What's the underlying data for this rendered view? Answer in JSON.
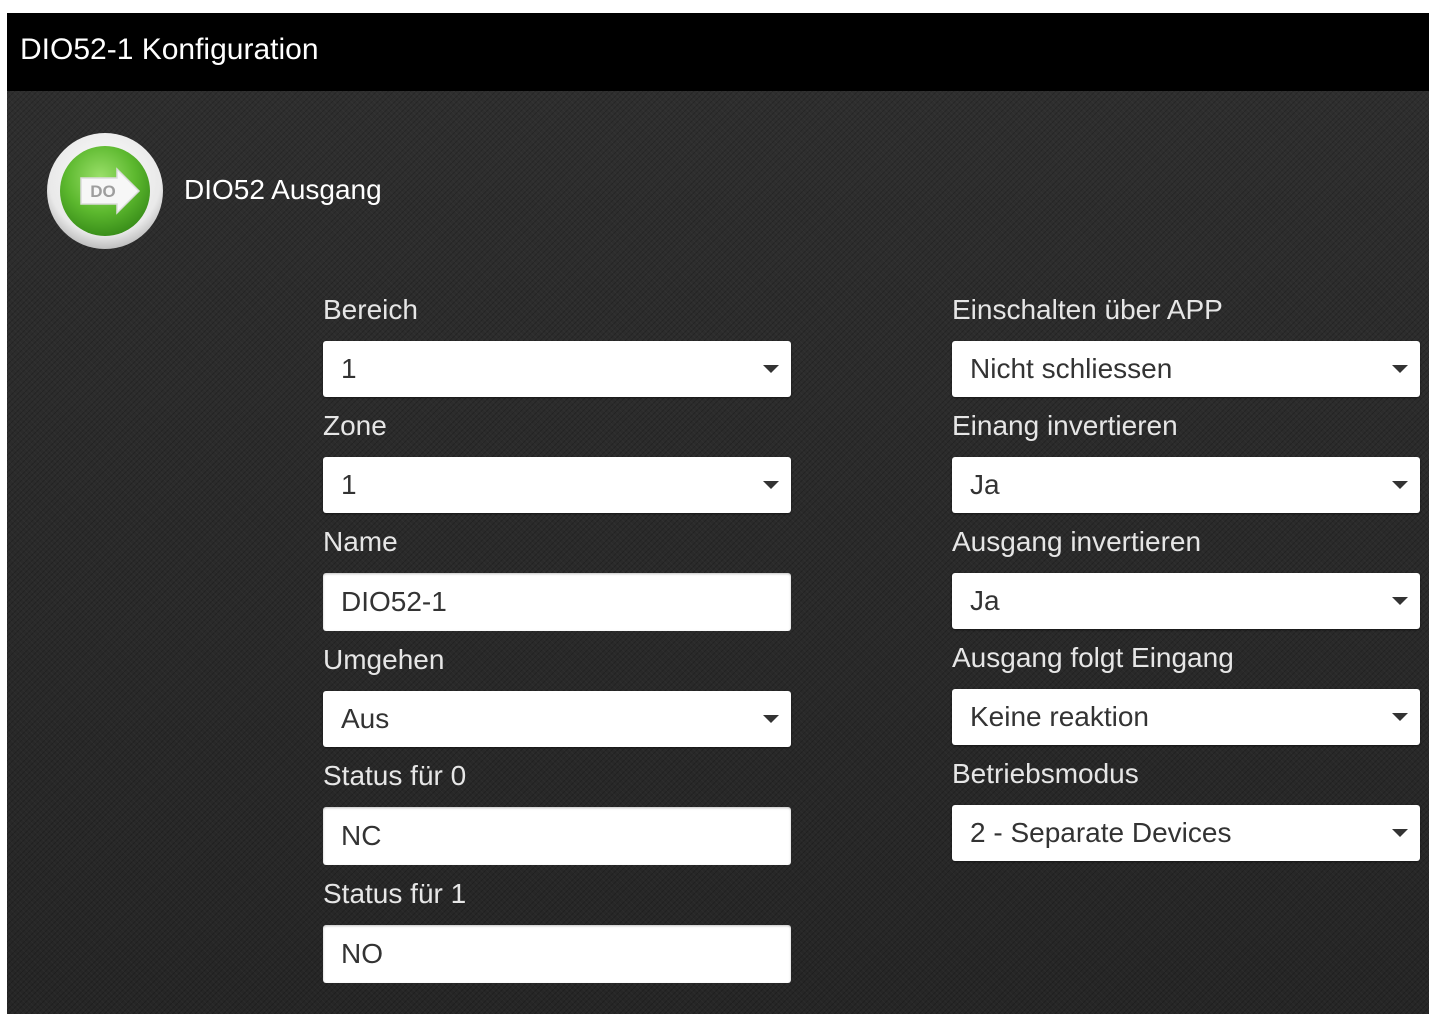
{
  "window": {
    "title": "DIO52-1 Konfiguration"
  },
  "device": {
    "icon_label": "DO",
    "icon": "digital-output-arrow-icon",
    "name": "DIO52 Ausgang"
  },
  "left": {
    "bereich": {
      "label": "Bereich",
      "value": "1"
    },
    "zone": {
      "label": "Zone",
      "value": "1"
    },
    "name": {
      "label": "Name",
      "value": "DIO52-1"
    },
    "umgehen": {
      "label": "Umgehen",
      "value": "Aus"
    },
    "status0": {
      "label": "Status für 0",
      "value": "NC"
    },
    "status1": {
      "label": "Status für 1",
      "value": "NO"
    }
  },
  "right": {
    "einschalten": {
      "label": "Einschalten über APP",
      "value": "Nicht schliessen"
    },
    "eingang_invert": {
      "label": "Einang invertieren",
      "value": "Ja"
    },
    "ausgang_invert": {
      "label": "Ausgang invertieren",
      "value": "Ja"
    },
    "ausgang_folgt": {
      "label": "Ausgang folgt Eingang",
      "value": "Keine reaktion"
    },
    "betriebsmodus": {
      "label": "Betriebsmodus",
      "value": "2 - Separate Devices"
    }
  },
  "colors": {
    "titlebar": "#000000",
    "panel": "#2b2b2b",
    "label_text": "#e6e6e6",
    "icon_green": "#5cb82e"
  }
}
